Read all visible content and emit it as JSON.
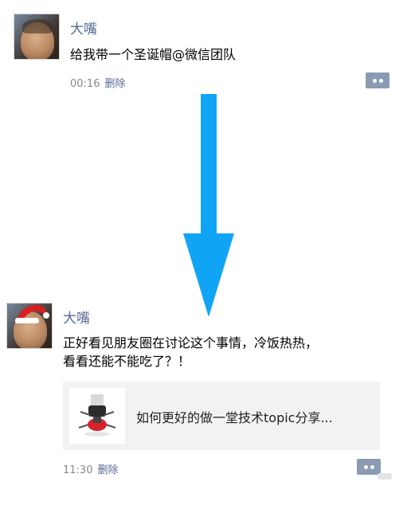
{
  "post1": {
    "author": "大嘴",
    "text": "给我带一个圣诞帽@微信团队",
    "time": "00:16",
    "delete_label": "删除"
  },
  "post2": {
    "author": "大嘴",
    "text_line1": "正好看见朋友圈在讨论这个事情，冷饭热热，",
    "text_line2": "看看还能不能吃了？！",
    "link_title": "如何更好的做一堂技术topic分享...",
    "time": "11:30",
    "delete_label": "删除"
  },
  "colors": {
    "name": "#576b95",
    "arrow": "#10a4f5",
    "comment_button": "#8a9bb3",
    "link_card_bg": "#f2f2f2"
  },
  "icons": {
    "arrow": "down-arrow-icon",
    "comment": "comment-dots-icon",
    "hat": "santa-hat-icon"
  }
}
